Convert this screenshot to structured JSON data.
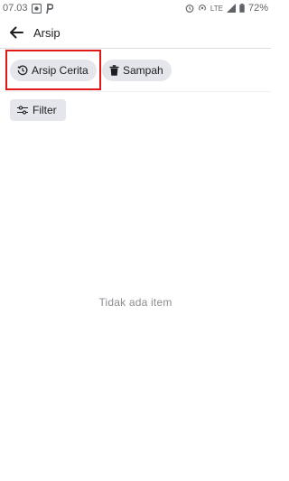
{
  "status_bar": {
    "time": "07.03",
    "network": "LTE",
    "battery": "72%"
  },
  "app_bar": {
    "title": "Arsip"
  },
  "filters": {
    "story_archive": "Arsip Cerita",
    "trash": "Sampah",
    "filter": "Filter"
  },
  "content": {
    "empty_message": "Tidak ada item"
  },
  "colors": {
    "highlight": "#e01818",
    "chip_bg": "#e4e6eb"
  }
}
